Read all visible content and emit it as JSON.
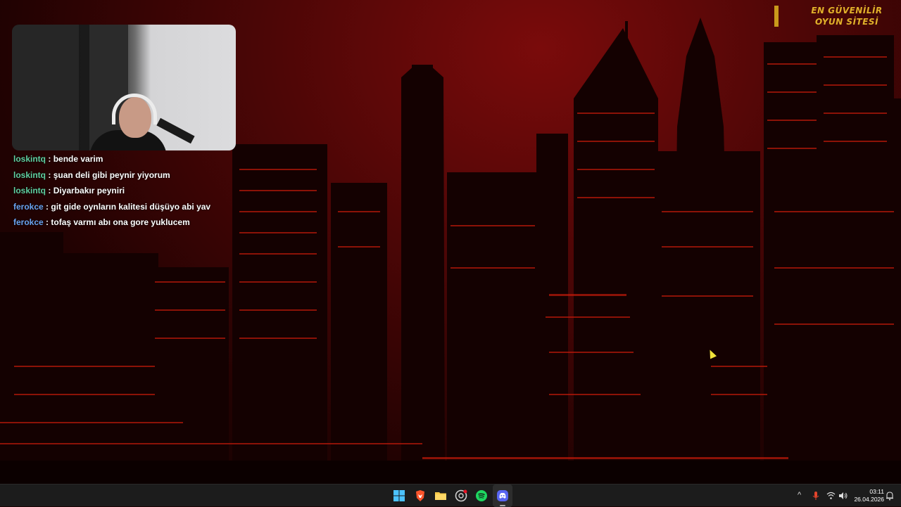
{
  "banner": {
    "line1": "EN GÜVENİLİR",
    "line2": "OYUN SİTESİ"
  },
  "chat": [
    {
      "user": "loskintq",
      "sep": " : ",
      "message": "bende varim",
      "color": "#5fcfa0"
    },
    {
      "user": "loskintq",
      "sep": " : ",
      "message": "şuan deli gibi peynir yiyorum",
      "color": "#5fcfa0"
    },
    {
      "user": "loskintq",
      "sep": " : ",
      "message": "Diyarbakır peyniri",
      "color": "#5fcfa0"
    },
    {
      "user": "ferokce",
      "sep": " : ",
      "message": "git gide oynların kalitesi düşüyo abi yav",
      "color": "#6aa3f0"
    },
    {
      "user": "ferokce",
      "sep": " : ",
      "message": "tofaş varmı abı ona gore yuklucem",
      "color": "#6aa3f0"
    }
  ],
  "taskbar": {
    "apps": [
      {
        "name": "windows-start-icon",
        "color": "#4cc2ff"
      },
      {
        "name": "brave-browser-icon",
        "color": "#fb542b"
      },
      {
        "name": "file-explorer-icon",
        "color": "#f7c948"
      },
      {
        "name": "chrome-extension-icon",
        "color": "#cfcfcf"
      },
      {
        "name": "spotify-icon",
        "color": "#1ed760"
      },
      {
        "name": "discord-icon",
        "color": "#5865f2"
      }
    ],
    "tray": {
      "chevron": "^",
      "time": "03:11",
      "date": "26.04.2026"
    }
  }
}
